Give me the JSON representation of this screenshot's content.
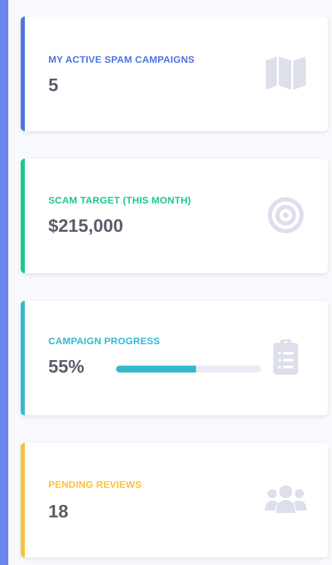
{
  "cards": [
    {
      "label": "MY ACTIVE SPAM CAMPAIGNS",
      "value": "5",
      "icon": "map-icon",
      "accent": "#4e73df"
    },
    {
      "label": "SCAM TARGET (THIS MONTH)",
      "value": "$215,000",
      "icon": "target-icon",
      "accent": "#1cc88a"
    },
    {
      "label": "CAMPAIGN PROGRESS",
      "value": "55%",
      "progress": 0.55,
      "icon": "clipboard-list-icon",
      "accent": "#36b9cc"
    },
    {
      "label": "PENDING REVIEWS",
      "value": "18",
      "icon": "users-icon",
      "accent": "#f6c23e"
    }
  ],
  "colors": {
    "background": "#6c86ef",
    "panel": "#f8f9fc",
    "card": "#ffffff",
    "value_text": "#5a5c69",
    "icon": "#dddfeb",
    "progress_track": "#eaecf4"
  }
}
